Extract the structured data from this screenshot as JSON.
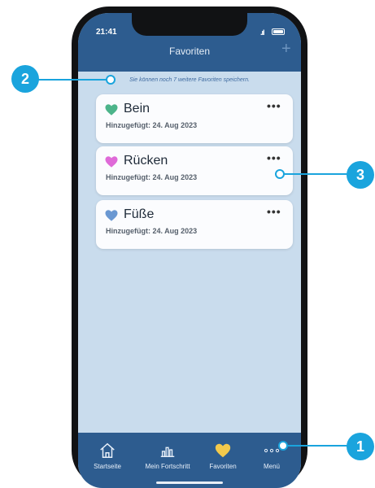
{
  "status_bar": {
    "time": "21:41"
  },
  "header": {
    "title": "Favoriten",
    "add_icon": "+"
  },
  "info_text": "Sie können noch 7 weitere Favoriten speichern.",
  "favorites": [
    {
      "name": "Bein",
      "added": "Hinzugefügt: 24. Aug 2023",
      "heart_color": "#4cb48a",
      "more": "•••"
    },
    {
      "name": "Rücken",
      "added": "Hinzugefügt: 24. Aug 2023",
      "heart_color": "#df6ad8",
      "more": "•••"
    },
    {
      "name": "Füße",
      "added": "Hinzugefügt: 24. Aug 2023",
      "heart_color": "#6a98d2",
      "more": "•••"
    }
  ],
  "bottom_nav": [
    {
      "label": "Startseite",
      "icon": "home-icon"
    },
    {
      "label": "Mein Fortschritt",
      "icon": "bar-chart-icon"
    },
    {
      "label": "Favoriten",
      "icon": "heart-icon",
      "color": "#f2c94c"
    },
    {
      "label": "Menü",
      "icon": "more-dots-icon"
    }
  ],
  "callouts": [
    "1",
    "2",
    "3"
  ]
}
